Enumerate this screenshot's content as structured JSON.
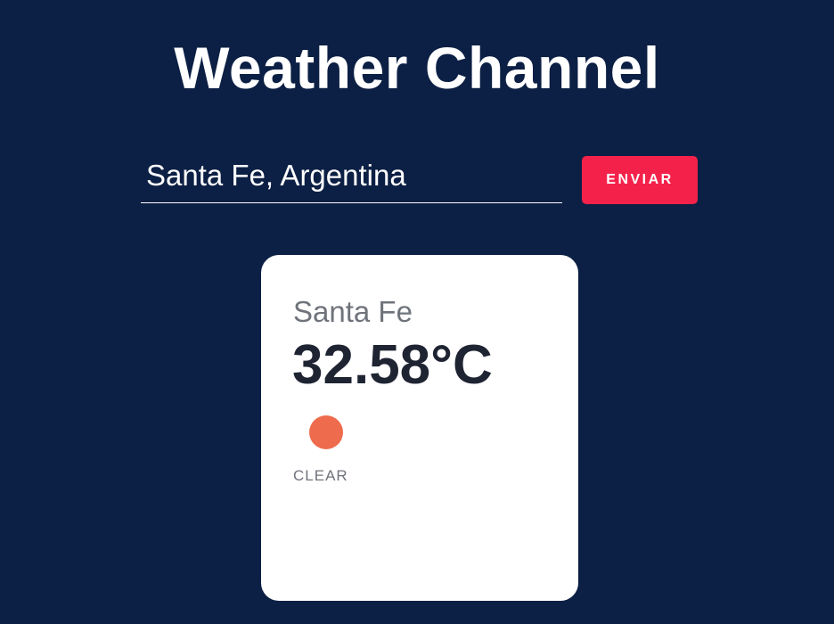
{
  "header": {
    "title": "Weather Channel"
  },
  "search": {
    "value": "Santa Fe, Argentina",
    "submit_label": "ENVIAR"
  },
  "weather_card": {
    "city": "Santa Fe",
    "temperature": "32.58°C",
    "condition": "CLEAR",
    "icon": "sun-icon",
    "icon_color": "#ee6b4d"
  },
  "colors": {
    "background": "#0c1f44",
    "accent": "#f4224a",
    "card": "#ffffff"
  }
}
